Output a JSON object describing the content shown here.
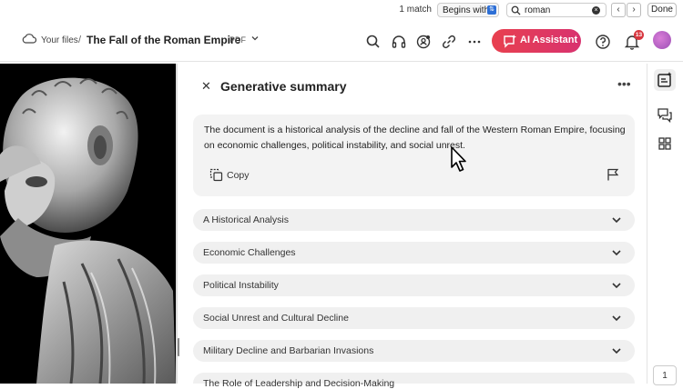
{
  "find_bar": {
    "match_count": "1 match",
    "mode": "Begins with",
    "query": "roman",
    "done_label": "Done"
  },
  "header": {
    "your_files": "Your files",
    "separator": "/",
    "title": "The Fall of the Roman Empire",
    "file_type": "PDF",
    "ai_assistant_label": "AI Assistant",
    "notification_count": "13",
    "icons": [
      "search-icon",
      "headphones-icon",
      "comment-user-icon",
      "link-icon",
      "more-icon",
      "help-icon",
      "bell-icon"
    ]
  },
  "panel": {
    "title": "Generative summary",
    "summary": "The document is a historical analysis of the decline and fall of the Western Roman Empire, focusing on economic challenges, political instability, and social unrest.",
    "copy_label": "Copy",
    "sections": [
      "A Historical Analysis",
      "Economic Challenges",
      "Political Instability",
      "Social Unrest and Cultural Decline",
      "Military Decline and Barbarian Invasions",
      "The Role of Leadership and Decision-Making"
    ]
  },
  "rail": {
    "page_number": "1"
  },
  "colors": {
    "ai_button": "#e8404f",
    "badge": "#d7373f",
    "accordion_bg": "#f0f0f0",
    "summary_bg": "#f3f3f3"
  }
}
